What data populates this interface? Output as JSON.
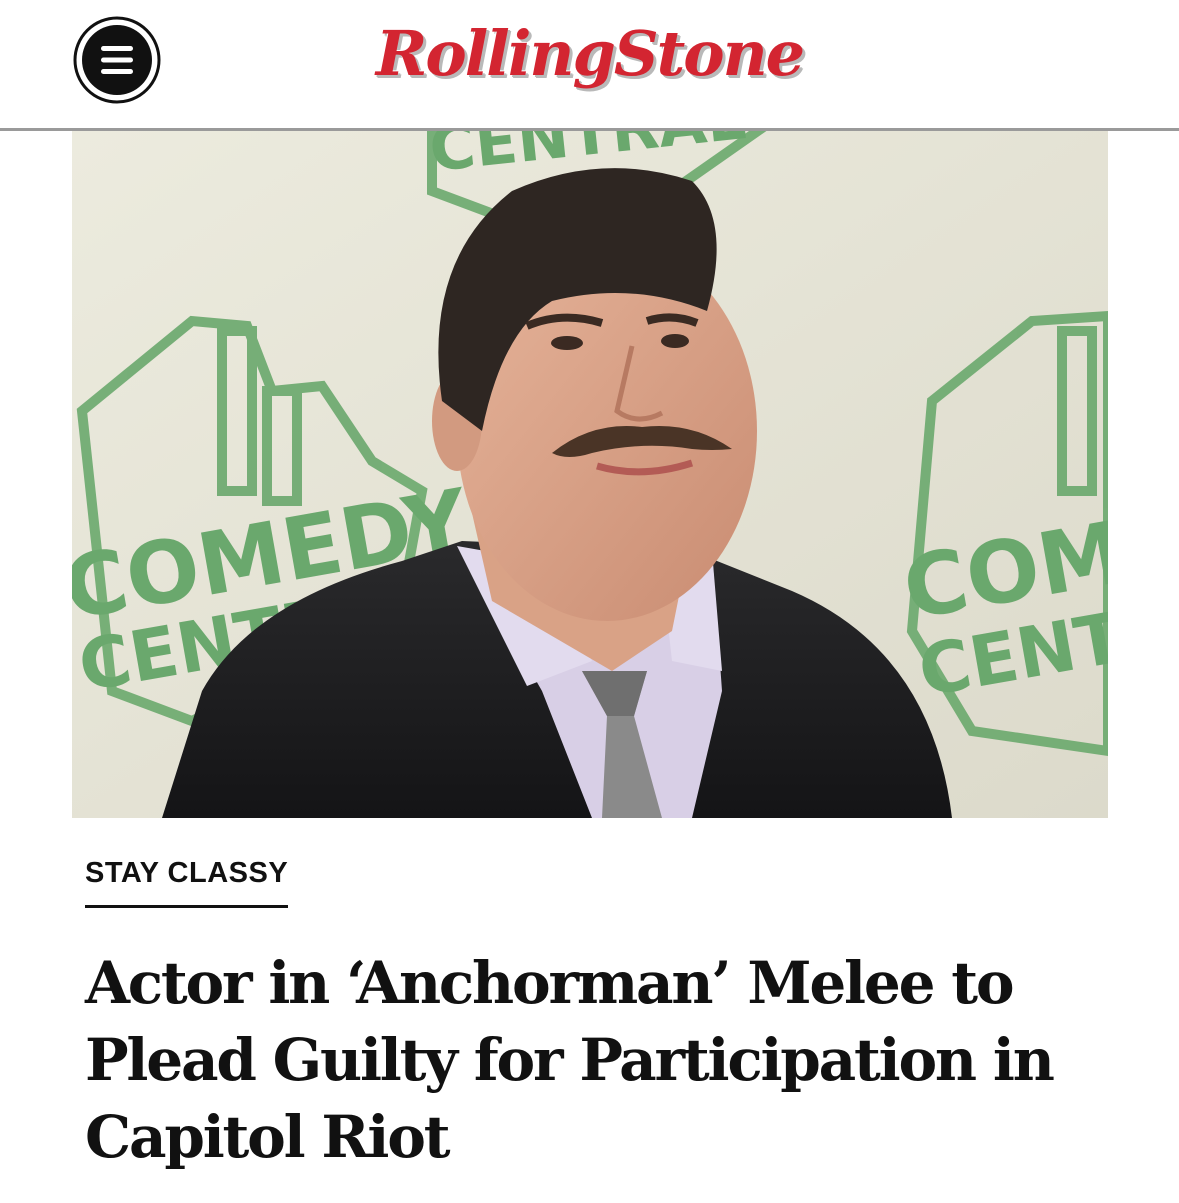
{
  "brand": {
    "logo_text": "RollingStone",
    "accent_color": "#d32531"
  },
  "header": {
    "menu_icon": "hamburger-menu-icon"
  },
  "hero_image": {
    "backdrop_text_left_1": "COMEDY",
    "backdrop_text_left_2": "CENTRAL",
    "backdrop_text_right_1": "COMEDY",
    "backdrop_text_right_2": "CENTRAL",
    "backdrop_text_top": "CENTRAL",
    "backdrop_color": "#6aa86d"
  },
  "article": {
    "kicker": "STAY CLASSY",
    "headline": "Actor in ‘Anchorman’ Melee to Plead Guilty for Participation in Capitol Riot"
  }
}
